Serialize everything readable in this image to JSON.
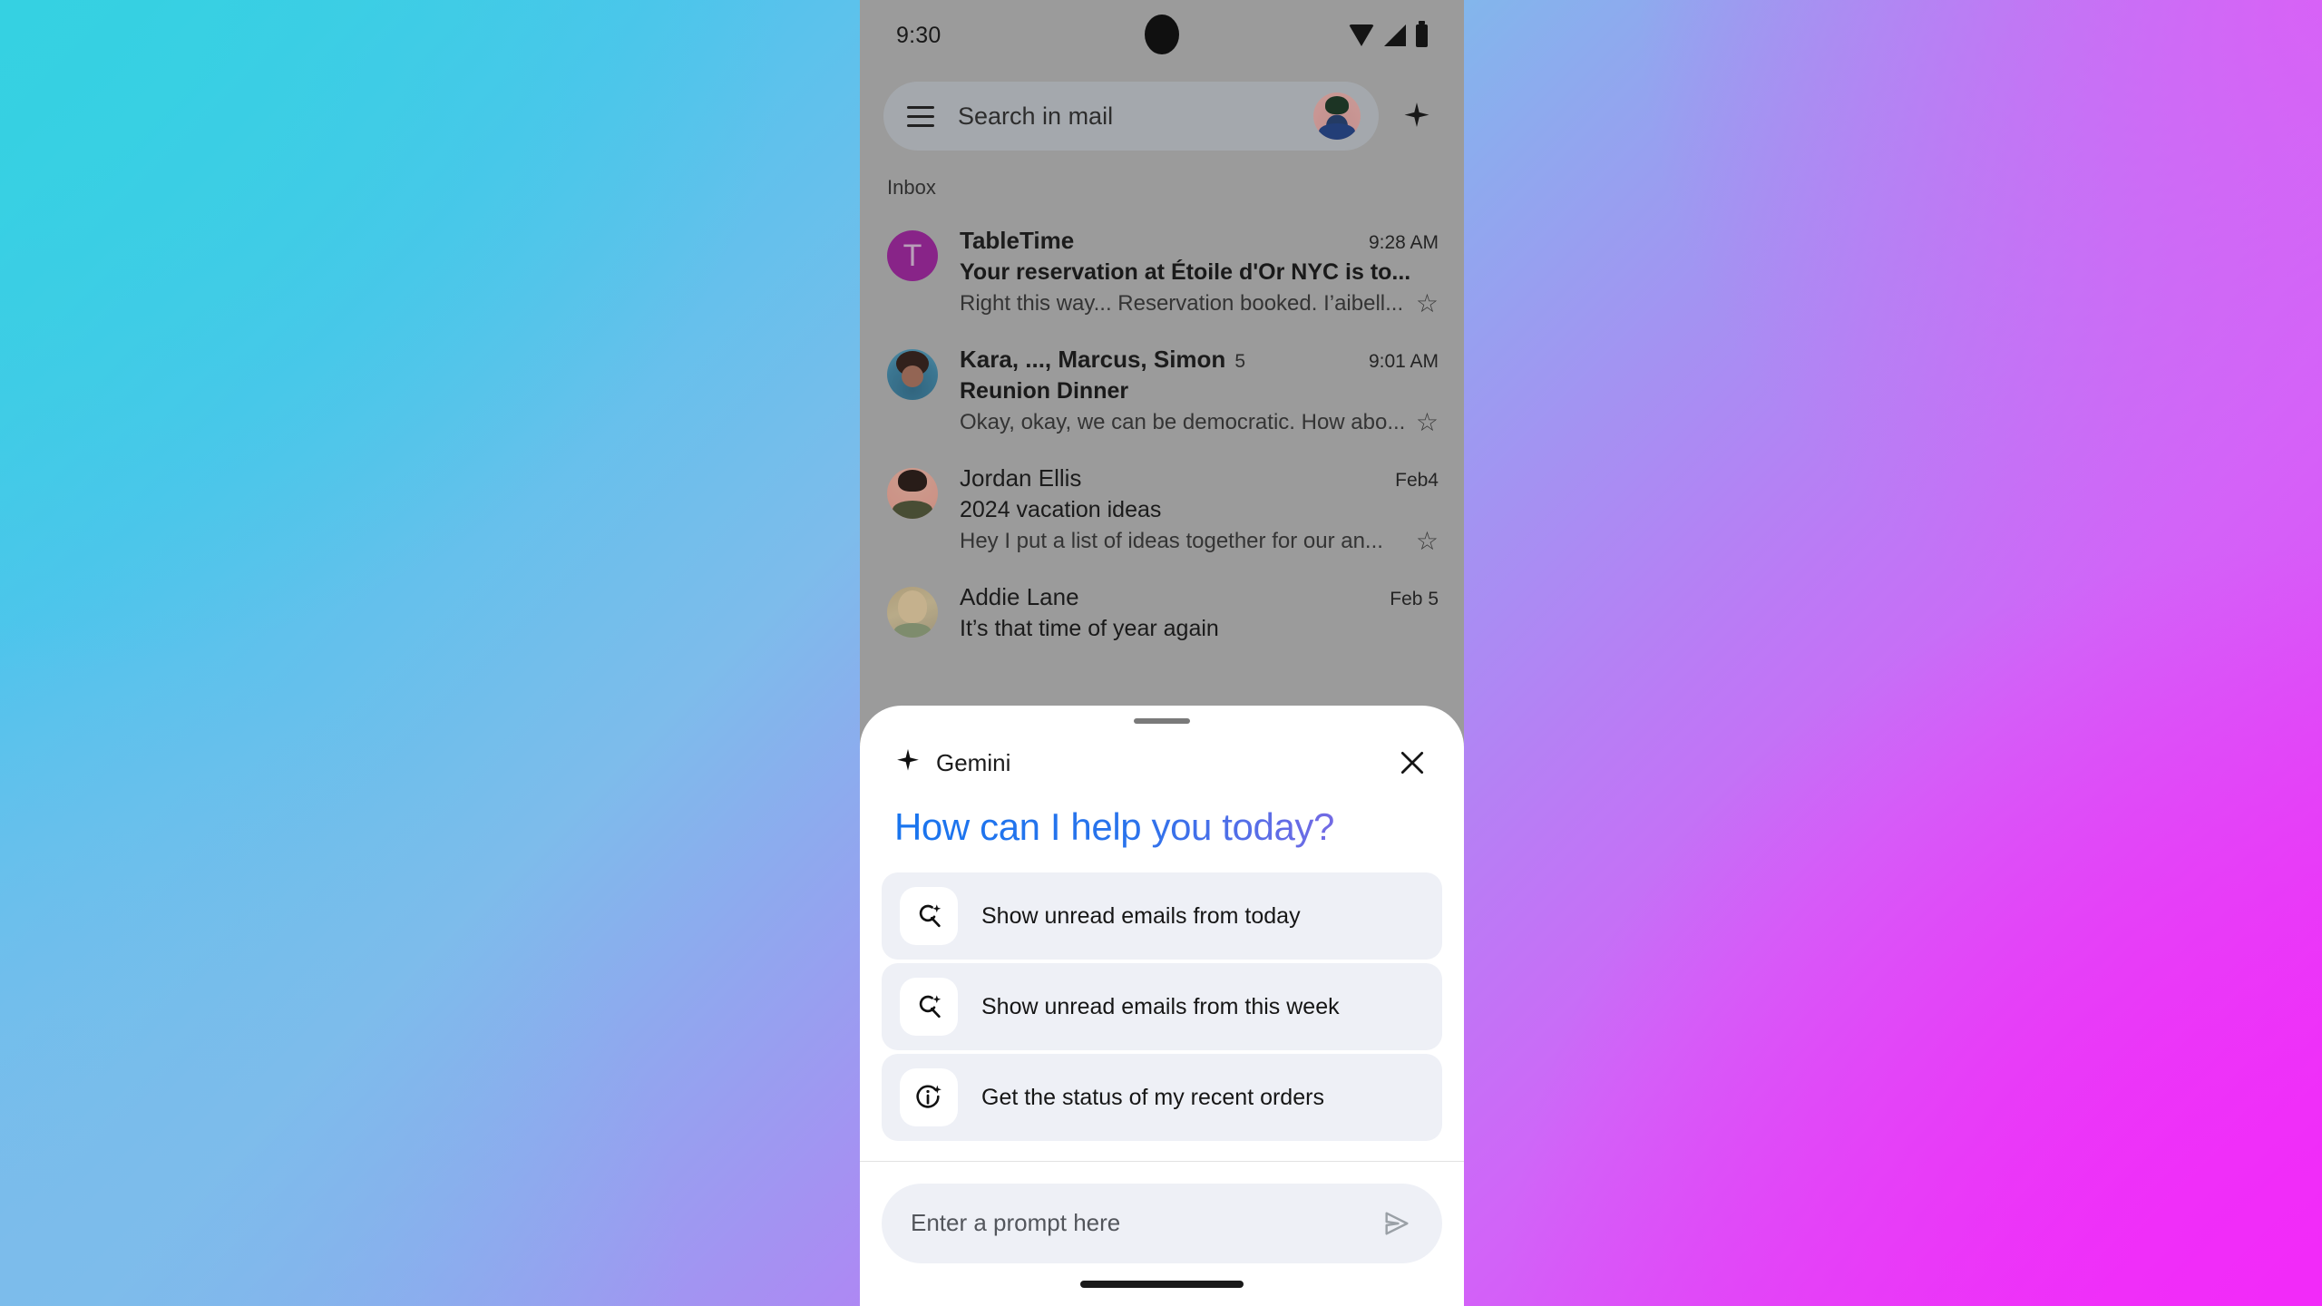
{
  "background": {
    "gradient_from": "#35D1E2",
    "gradient_to": "#F22AF9",
    "corner_top_left": "#35D1E2",
    "corner_top_right": "#DD5DF7",
    "corner_bottom_left": "#7DBCEB",
    "corner_bottom_right": "#F22AF9"
  },
  "phone": {
    "status_bar": {
      "time": "9:30",
      "icons": [
        "wifi-icon",
        "signal-icon",
        "battery-icon"
      ]
    },
    "search": {
      "menu_icon": "hamburger-menu-icon",
      "placeholder": "Search in mail",
      "avatar": "account-avatar",
      "assistant_icon": "gemini-sparkle-icon"
    },
    "inbox_label": "Inbox",
    "emails": [
      {
        "avatar_letter": "T",
        "avatar_color": "#9C1F9C",
        "sender": "TableTime",
        "count": "",
        "time": "9:28 AM",
        "subject": "Your reservation at Étoile d'Or NYC is to...",
        "snippet": "Right this way... Reservation booked. I’aibell...",
        "unread": true
      },
      {
        "avatar_letter": "",
        "avatar_color": "#3C86A8",
        "sender": "Kara, ..., Marcus, Simon",
        "count": "5",
        "time": "9:01 AM",
        "subject": "Reunion Dinner",
        "snippet": "Okay, okay, we can be democratic. How abo...",
        "unread": true
      },
      {
        "avatar_letter": "",
        "avatar_color": "#EFA898",
        "sender": "Jordan Ellis",
        "count": "",
        "time": "Feb4",
        "subject": "2024 vacation ideas",
        "snippet": "Hey I put a list of ideas together for our an...",
        "unread": false
      },
      {
        "avatar_letter": "",
        "avatar_color": "#D8C79C",
        "sender": "Addie Lane",
        "count": "",
        "time": "Feb 5",
        "subject": "It’s that time of year again",
        "snippet": "",
        "unread": false
      }
    ],
    "star_glyph": "☆"
  },
  "sheet": {
    "drag_handle": "drag-handle",
    "title": "Gemini",
    "title_icon": "gemini-sparkle-icon",
    "close_icon": "close-icon",
    "headline": "How can I help you today?",
    "headline_gradient_from": "#1675EF",
    "headline_gradient_to": "#9D68DD",
    "suggestions": [
      {
        "icon": "search-sparkle-icon",
        "label": "Show unread emails from today"
      },
      {
        "icon": "search-sparkle-icon",
        "label": "Show unread emails from this week"
      },
      {
        "icon": "info-sparkle-icon",
        "label": "Get the status of my recent orders"
      }
    ],
    "prompt": {
      "placeholder": "Enter a prompt here",
      "value": "",
      "send_icon": "send-icon"
    },
    "nav_pill": "home-indicator"
  }
}
